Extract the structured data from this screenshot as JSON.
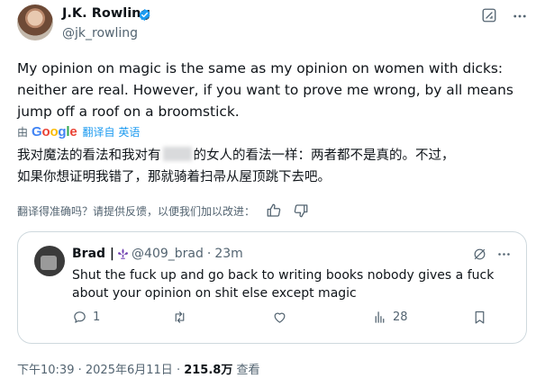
{
  "author": {
    "name": "J.K. Rowling",
    "handle": "@jk_rowling"
  },
  "tweet": {
    "lines": [
      "My opinion on magic is the same as my opinion on women with dicks:",
      "neither are real. However, if you want to prove me wrong, by all means",
      "jump off a roof on a broomstick."
    ]
  },
  "translation": {
    "prefix": "由",
    "brand": "Google",
    "link_label": "翻译自 英语",
    "text_part1": "我对魔法的看法和我对有",
    "text_part2": "的女人的看法一样：两者都不是真的。不过，",
    "text_line2": "如果你想证明我错了，那就骑着扫帚从屋顶跳下去吧。",
    "feedback_prompt": "翻译得准确吗？请提供反馈，以便我们加以改进："
  },
  "quote": {
    "name": "Brad |",
    "handle": "@409_brad",
    "separator": "·",
    "time": "23m",
    "text": "Shut the fuck up and go back to writing books nobody gives a fuck about your opinion on shit else except magic",
    "reply_count": "1",
    "retweet_count": "",
    "like_count": "",
    "views_count": "28"
  },
  "meta": {
    "time": "下午10:39",
    "sep1": "·",
    "date": "2025年6月11日",
    "sep2": "·",
    "views": "215.8万",
    "views_label": "查看"
  },
  "colors": {
    "accent": "#1d9bf0",
    "text_primary": "#0f1419",
    "text_secondary": "#536471",
    "border": "#cfd9de",
    "verified": "#1d9bf0"
  },
  "icons": {
    "verified": "verified-badge-icon",
    "grok": "grok-icon",
    "more": "more-icon",
    "fleur": "fleur-de-lis-icon",
    "hide": "hide-icon",
    "reply": "reply-icon",
    "retweet": "retweet-icon",
    "like": "like-icon",
    "analytics": "analytics-icon",
    "bookmark": "bookmark-icon",
    "thumbs_up": "thumbs-up-icon",
    "thumbs_down": "thumbs-down-icon"
  }
}
